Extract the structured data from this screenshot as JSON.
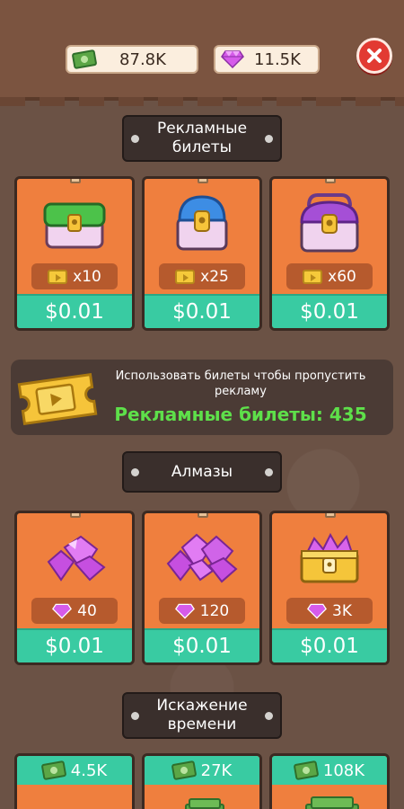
{
  "currency": {
    "cash": "87.8K",
    "gems": "11.5K"
  },
  "sections": {
    "tickets": {
      "title_line1": "Рекламные",
      "title_line2": "билеты",
      "items": [
        {
          "amount": "x10",
          "price": "$0.01",
          "icon": "green-chest-icon"
        },
        {
          "amount": "x25",
          "price": "$0.01",
          "icon": "blue-chest-icon"
        },
        {
          "amount": "x60",
          "price": "$0.01",
          "icon": "purple-chest-icon"
        }
      ]
    },
    "info": {
      "line1": "Использовать билеты чтобы пропустить рекламу",
      "line2": "Рекламные билеты: 435"
    },
    "gems": {
      "title": "Алмазы",
      "items": [
        {
          "amount": "40",
          "price": "$0.01",
          "icon": "gem-pile-small-icon"
        },
        {
          "amount": "120",
          "price": "$0.01",
          "icon": "gem-pile-large-icon"
        },
        {
          "amount": "3K",
          "price": "$0.01",
          "icon": "gem-treasure-chest-icon"
        }
      ]
    },
    "timewarp": {
      "title_line1": "Искажение",
      "title_line2": "времени",
      "items": [
        {
          "amount": "4.5K",
          "icon": "cash-icon"
        },
        {
          "amount": "27K",
          "icon": "cash-icon"
        },
        {
          "amount": "108K",
          "icon": "cash-icon"
        }
      ]
    }
  },
  "colors": {
    "card": "#ef7f3e",
    "price_bar": "#39cba2",
    "highlight_text": "#5ee04a",
    "close": "#e23a32"
  }
}
